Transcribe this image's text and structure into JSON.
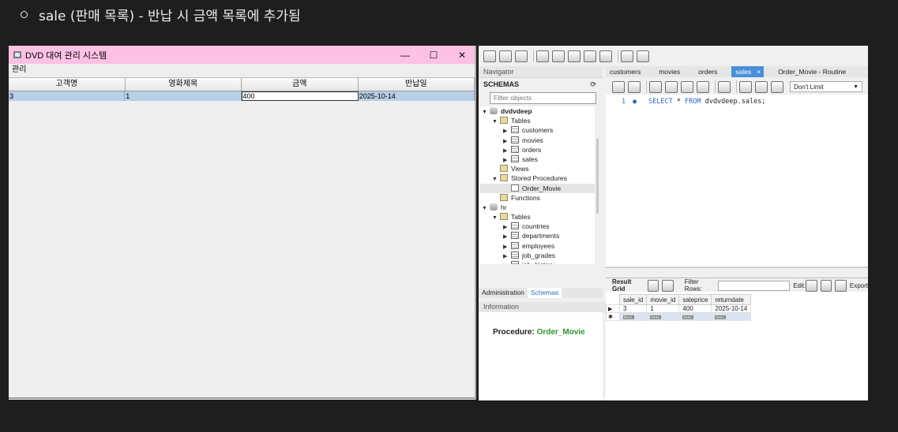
{
  "heading": "sale (판매 목록) - 반납 시 금액 목록에 추가됨",
  "java_window": {
    "title": "DVD 대여 관리 시스템",
    "controls": [
      "—",
      "☐",
      "✕"
    ],
    "menu": "관리",
    "columns": [
      "고객명",
      "영화제목",
      "금액",
      "반납일"
    ],
    "row": [
      "3",
      "1",
      "400",
      "2025-10-14"
    ]
  },
  "workbench": {
    "navigator_label": "Navigator",
    "schemas_label": "SCHEMAS",
    "filter_placeholder": "Filter objects",
    "tree": [
      {
        "label": "dvdvdeep",
        "bold": true
      },
      {
        "label": "Tables"
      },
      {
        "label": "customers"
      },
      {
        "label": "movies"
      },
      {
        "label": "orders"
      },
      {
        "label": "sales"
      },
      {
        "label": "Views"
      },
      {
        "label": "Stored Procedures"
      },
      {
        "label": "Order_Movie"
      },
      {
        "label": "Functions"
      },
      {
        "label": "hr"
      },
      {
        "label": "Tables"
      },
      {
        "label": "countries"
      },
      {
        "label": "departments"
      },
      {
        "label": "employees"
      },
      {
        "label": "job_grades"
      },
      {
        "label": "job_history"
      }
    ],
    "nav_tabs": [
      "Administration",
      "Schemas"
    ],
    "information_label": "Information",
    "procedure_label": "Procedure:",
    "procedure_name": "Order_Movie",
    "editor_tabs": [
      "customers",
      "movies",
      "orders",
      "sales",
      "Order_Movie - Routine"
    ],
    "active_tab_close": "×",
    "limit_label": "Don't Limit",
    "sql_line_number": "1",
    "sql_keyword1": "SELECT",
    "sql_star": "*",
    "sql_keyword2": "FROM",
    "sql_rest": "dvdvdeep.sales;",
    "result_grid_label": "Result Grid",
    "filter_rows_label": "Filter Rows:",
    "edit_label": "Edit:",
    "export_label": "Export",
    "grid_columns": [
      "sale_id",
      "movie_id",
      "saleprice",
      "returndate"
    ],
    "grid_row": [
      "3",
      "1",
      "400",
      "2025-10-14"
    ],
    "null_text": "NULL"
  }
}
